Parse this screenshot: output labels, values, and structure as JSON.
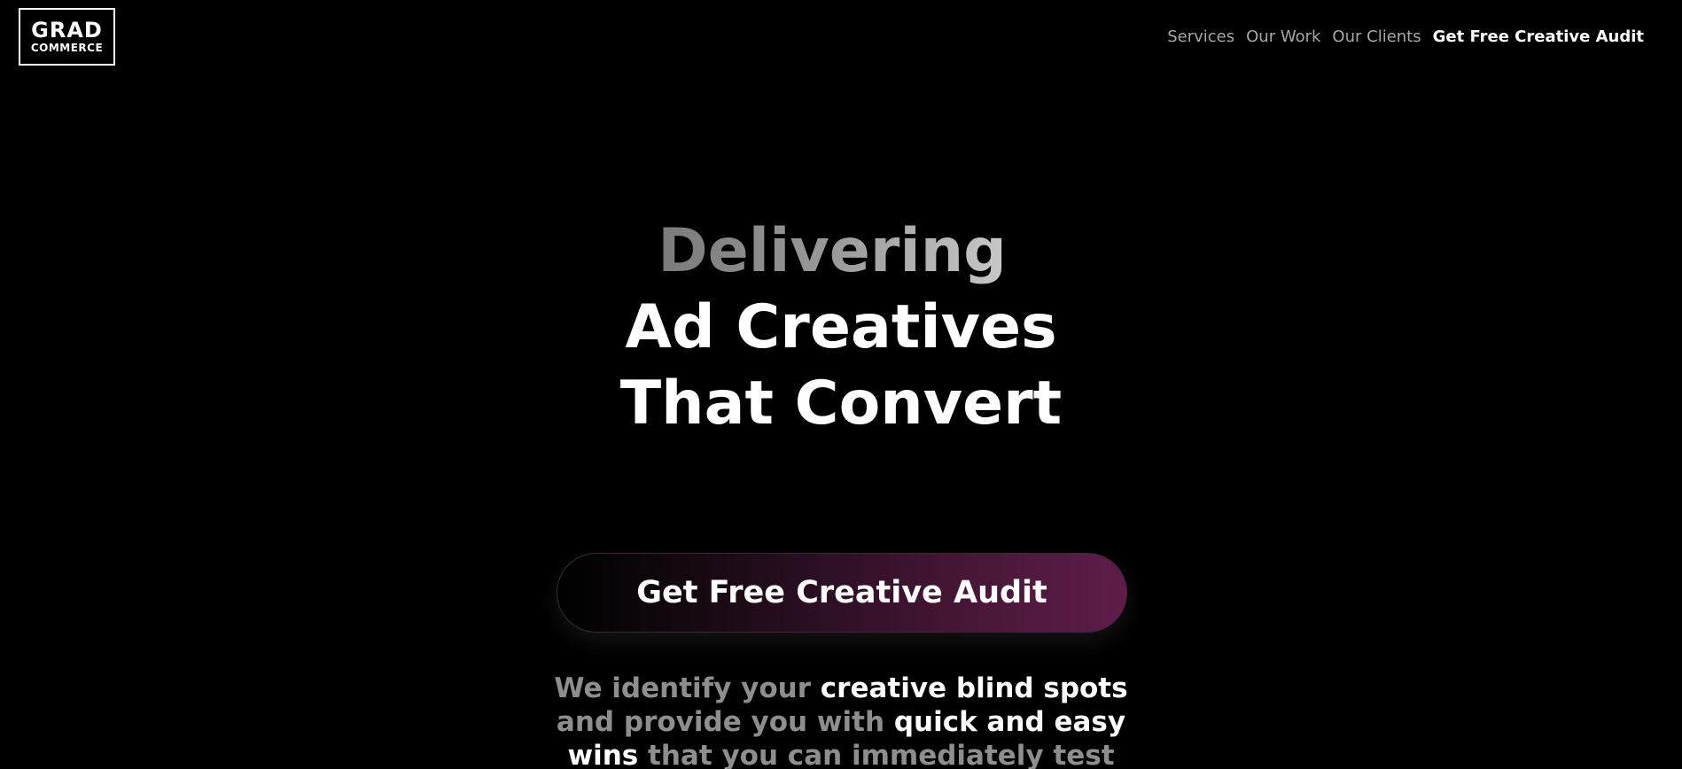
{
  "logo": {
    "top": "GRAD",
    "bottom": "COMMERCE"
  },
  "nav": {
    "items": [
      {
        "label": "Services"
      },
      {
        "label": "Our Work"
      },
      {
        "label": "Our Clients"
      },
      {
        "label": "Get Free Creative Audit"
      }
    ]
  },
  "hero": {
    "headline": {
      "line1": "Delivering",
      "line2": "Ad Creatives",
      "line3": "That Convert"
    },
    "cta_label": "Get Free Creative Audit",
    "subtext": {
      "line1_muted": "We identify your ",
      "line1_strong": "creative blind spots",
      "line2_muted": "and provide you with ",
      "line2_strong": "quick and easy",
      "line3_strong": "wins",
      "line3_muted": " that you can immediately test"
    }
  },
  "colors": {
    "background": "#000000",
    "text_primary": "#ffffff",
    "text_muted": "#8e8e8e",
    "nav_muted": "#a8a8a8",
    "cta_gradient_end": "#5e1d48"
  }
}
